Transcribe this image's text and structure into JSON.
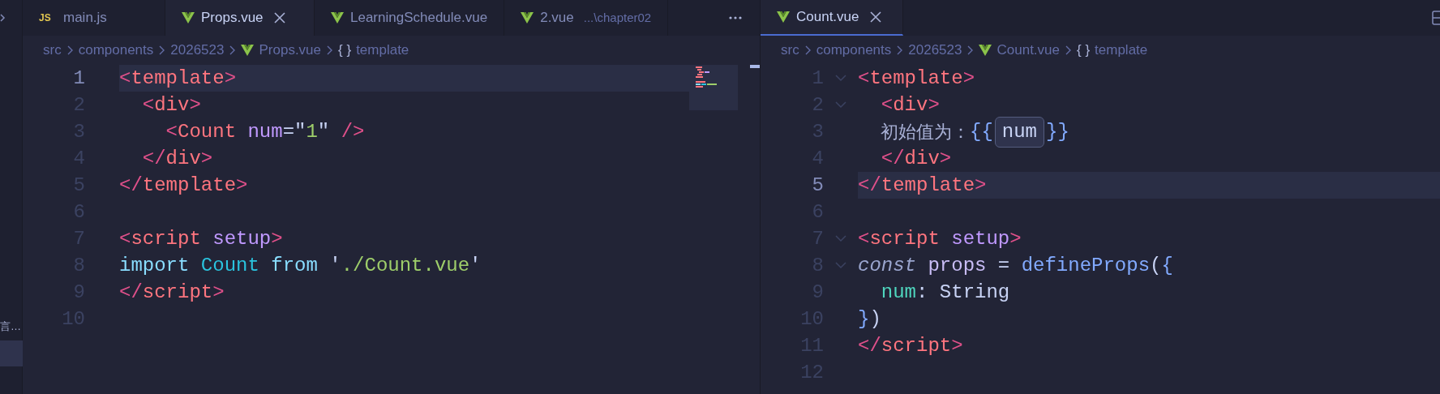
{
  "sidebar": {
    "item_label": "言…",
    "item_selected": true
  },
  "groups": [
    {
      "focused": false,
      "minimap": true,
      "tabs": [
        {
          "kind": "js",
          "icon_label": "JS",
          "label": "main.js",
          "selected": false
        },
        {
          "kind": "vue",
          "label": "Props.vue",
          "selected": true
        },
        {
          "kind": "vue",
          "label": "LearningSchedule.vue",
          "selected": false
        },
        {
          "kind": "vue",
          "label": "2.vue",
          "description": "...\\chapter02",
          "selected": false
        }
      ],
      "breadcrumbs": [
        {
          "label": "src"
        },
        {
          "label": "components"
        },
        {
          "label": "2026523"
        },
        {
          "kind": "vue",
          "label": "Props.vue"
        },
        {
          "kind": "symbol",
          "glyph": "{ }",
          "label": "template"
        }
      ],
      "lines": [
        {
          "number": "1",
          "current": true,
          "tokens": [
            {
              "kind": "br",
              "text": "<"
            },
            {
              "kind": "tag",
              "text": "template"
            },
            {
              "kind": "br",
              "text": ">"
            }
          ]
        },
        {
          "number": "2",
          "current": false,
          "tokens": [
            {
              "kind": "br",
              "text": "  <"
            },
            {
              "kind": "tag",
              "text": "div"
            },
            {
              "kind": "br",
              "text": ">"
            }
          ]
        },
        {
          "number": "3",
          "current": false,
          "tokens": [
            {
              "kind": "br",
              "text": "    <"
            },
            {
              "kind": "tag",
              "text": "Count"
            },
            {
              "kind": "attr",
              "text": " num"
            },
            {
              "kind": "op",
              "text": "=\""
            },
            {
              "kind": "str",
              "text": "1"
            },
            {
              "kind": "op",
              "text": "\""
            },
            {
              "kind": "br",
              "text": " />"
            }
          ]
        },
        {
          "number": "4",
          "current": false,
          "tokens": [
            {
              "kind": "br",
              "text": "  </"
            },
            {
              "kind": "tag",
              "text": "div"
            },
            {
              "kind": "br",
              "text": ">"
            }
          ]
        },
        {
          "number": "5",
          "current": false,
          "tokens": [
            {
              "kind": "br",
              "text": "</"
            },
            {
              "kind": "tag",
              "text": "template"
            },
            {
              "kind": "br",
              "text": ">"
            }
          ]
        },
        {
          "number": "6",
          "current": false
        },
        {
          "number": "7",
          "current": false,
          "tokens": [
            {
              "kind": "br",
              "text": "<"
            },
            {
              "kind": "tag",
              "text": "script"
            },
            {
              "kind": "attr",
              "text": " setup"
            },
            {
              "kind": "br",
              "text": ">"
            }
          ]
        },
        {
          "number": "8",
          "current": false,
          "tokens": [
            {
              "kind": "kw",
              "text": "import"
            },
            {
              "kind": "cls",
              "text": " Count"
            },
            {
              "kind": "kw",
              "text": " from"
            },
            {
              "kind": "op",
              "text": " '"
            },
            {
              "kind": "str",
              "text": "./Count.vue"
            },
            {
              "kind": "op",
              "text": "'"
            }
          ]
        },
        {
          "number": "9",
          "current": false,
          "tokens": [
            {
              "kind": "br",
              "text": "</"
            },
            {
              "kind": "tag",
              "text": "script"
            },
            {
              "kind": "br",
              "text": ">"
            }
          ]
        },
        {
          "number": "10",
          "current": false
        }
      ]
    },
    {
      "focused": true,
      "tabs": [
        {
          "kind": "vue",
          "label": "Count.vue",
          "selected": true
        }
      ],
      "breadcrumbs": [
        {
          "label": "src"
        },
        {
          "label": "components"
        },
        {
          "label": "2026523"
        },
        {
          "kind": "vue",
          "label": "Count.vue"
        },
        {
          "kind": "symbol",
          "glyph": "{ }",
          "label": "template"
        }
      ],
      "lines": [
        {
          "number": "1",
          "current": false,
          "foldable": true,
          "tokens": [
            {
              "kind": "br",
              "text": "<"
            },
            {
              "kind": "tag",
              "text": "template"
            },
            {
              "kind": "br",
              "text": ">"
            }
          ]
        },
        {
          "number": "2",
          "current": false,
          "foldable": true,
          "tokens": [
            {
              "kind": "br",
              "text": "  <"
            },
            {
              "kind": "tag",
              "text": "div"
            },
            {
              "kind": "br",
              "text": ">"
            }
          ]
        },
        {
          "number": "3",
          "current": false,
          "foldable": false,
          "tokens": [
            {
              "kind": "text",
              "text": "    初始值为："
            },
            {
              "kind": "mus",
              "text": "{{"
            },
            {
              "kind": "inlay",
              "text": "num"
            },
            {
              "kind": "mus",
              "text": "}}"
            }
          ]
        },
        {
          "number": "4",
          "current": false,
          "foldable": false,
          "tokens": [
            {
              "kind": "br",
              "text": "  </"
            },
            {
              "kind": "tag",
              "text": "div"
            },
            {
              "kind": "br",
              "text": ">"
            }
          ]
        },
        {
          "number": "5",
          "current": true,
          "foldable": false,
          "tokens": [
            {
              "kind": "br",
              "text": "</"
            },
            {
              "kind": "tag",
              "text": "template"
            },
            {
              "kind": "br",
              "text": ">"
            }
          ]
        },
        {
          "number": "6",
          "current": false,
          "foldable": false
        },
        {
          "number": "7",
          "current": false,
          "foldable": true,
          "tokens": [
            {
              "kind": "br",
              "text": "<"
            },
            {
              "kind": "tag",
              "text": "script"
            },
            {
              "kind": "attr",
              "text": " setup"
            },
            {
              "kind": "br",
              "text": ">"
            }
          ]
        },
        {
          "number": "8",
          "current": false,
          "foldable": true,
          "tokens": [
            {
              "kind": "const",
              "text": "const"
            },
            {
              "kind": "var",
              "text": " props"
            },
            {
              "kind": "op",
              "text": " ="
            },
            {
              "kind": "fn",
              "text": " defineProps"
            },
            {
              "kind": "plain",
              "text": "("
            },
            {
              "kind": "mus",
              "text": "{"
            }
          ]
        },
        {
          "number": "9",
          "current": false,
          "foldable": false,
          "tokens": [
            {
              "kind": "prop",
              "text": "  num"
            },
            {
              "kind": "op",
              "text": ":"
            },
            {
              "kind": "plain",
              "text": " String"
            }
          ]
        },
        {
          "number": "10",
          "current": false,
          "foldable": false,
          "tokens": [
            {
              "kind": "mus",
              "text": "}"
            },
            {
              "kind": "plain",
              "text": ")"
            }
          ]
        },
        {
          "number": "11",
          "current": false,
          "foldable": false,
          "tokens": [
            {
              "kind": "br",
              "text": "</"
            },
            {
              "kind": "tag",
              "text": "script"
            },
            {
              "kind": "br",
              "text": ">"
            }
          ]
        },
        {
          "number": "12",
          "current": false,
          "foldable": false
        }
      ]
    }
  ]
}
